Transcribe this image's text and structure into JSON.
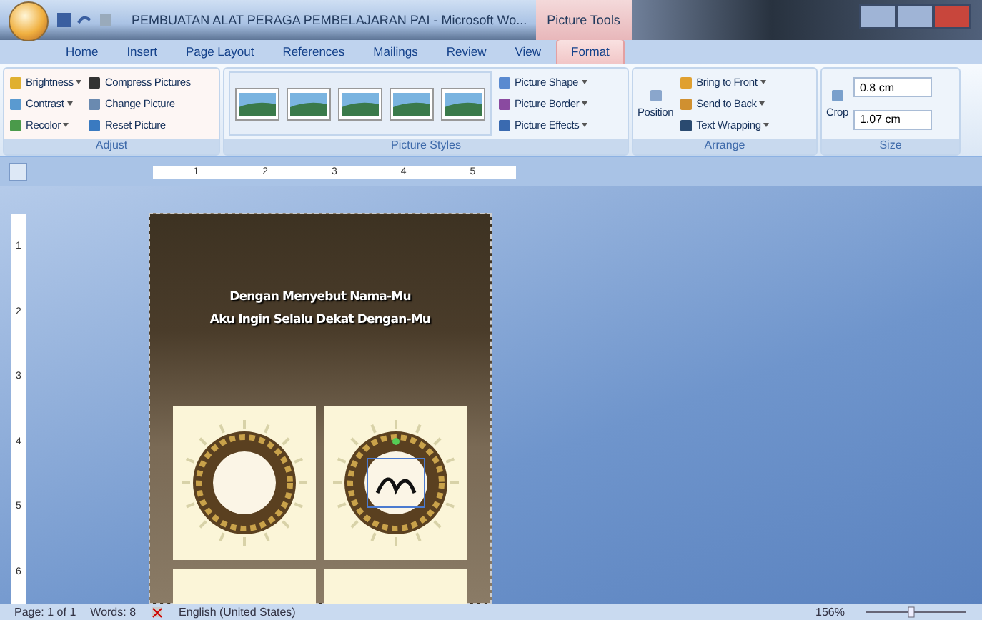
{
  "window": {
    "title": "PEMBUATAN ALAT PERAGA PEMBELAJARAN PAI - Microsoft Wo...",
    "context_tab": "Picture Tools"
  },
  "tabs": [
    {
      "label": "Home",
      "selected": false
    },
    {
      "label": "Insert",
      "selected": false
    },
    {
      "label": "Page Layout",
      "selected": false
    },
    {
      "label": "References",
      "selected": false
    },
    {
      "label": "Mailings",
      "selected": false
    },
    {
      "label": "Review",
      "selected": false
    },
    {
      "label": "View",
      "selected": false
    },
    {
      "label": "Format",
      "selected": true
    }
  ],
  "ribbon": {
    "adjust": {
      "title": "Adjust",
      "items": [
        {
          "label": "Brightness",
          "dropdown": true
        },
        {
          "label": "Compress Pictures",
          "dropdown": false
        },
        {
          "label": "Contrast",
          "dropdown": true
        },
        {
          "label": "Change Picture",
          "dropdown": false
        },
        {
          "label": "Recolor",
          "dropdown": true
        },
        {
          "label": "Reset Picture",
          "dropdown": false
        }
      ]
    },
    "styles": {
      "title": "Picture Styles",
      "items": [
        {
          "label": "Picture Shape",
          "dropdown": true
        },
        {
          "label": "Picture Border",
          "dropdown": true
        },
        {
          "label": "Picture Effects",
          "dropdown": true
        }
      ]
    },
    "arrange": {
      "title": "Arrange",
      "position": "Position",
      "items": [
        {
          "label": "Bring to Front",
          "dropdown": true
        },
        {
          "label": "Send to Back",
          "dropdown": true
        },
        {
          "label": "Text Wrapping",
          "dropdown": true
        }
      ]
    },
    "size": {
      "title": "Size",
      "crop": "Crop",
      "height": "0.8 cm",
      "width": "1.07 cm"
    }
  },
  "ruler": [
    "1",
    "2",
    "3",
    "4",
    "5"
  ],
  "vruler": [
    "1",
    "2",
    "3",
    "4",
    "5",
    "6"
  ],
  "document": {
    "heading": [
      "Dengan Menyebut Nama-Mu",
      "Aku Ingin Selalu Dekat Dengan-Mu"
    ]
  },
  "status_bar": {
    "page": "Page: 1 of 1",
    "words": "Words: 8",
    "language": "English (United States)",
    "zoom": "156%",
    "zoom_slider": {
      "level": 0.45
    }
  }
}
